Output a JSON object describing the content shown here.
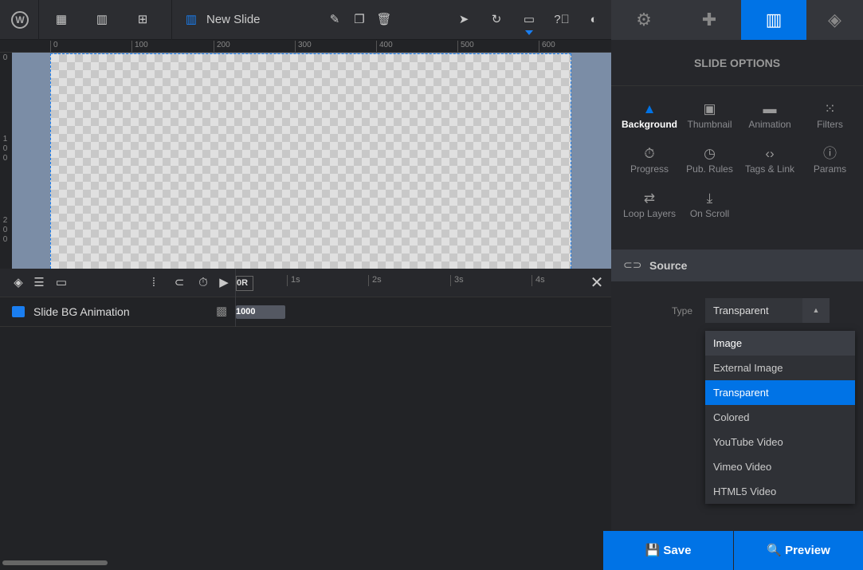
{
  "topbar": {
    "title": "New Slide",
    "icons": [
      "wordpress-icon",
      "grid-icon",
      "slides-icon",
      "add-slide-icon",
      "slide-icon",
      "pencil-icon",
      "copy-icon",
      "trash-icon",
      "cursor-icon",
      "undo-icon",
      "desktop-icon",
      "help-icon",
      "contrast-icon"
    ]
  },
  "ruler": {
    "h": [
      "0",
      "100",
      "200",
      "300",
      "400",
      "500",
      "600"
    ],
    "v": [
      "0",
      "1",
      "0",
      "0",
      "2",
      "0",
      "0"
    ]
  },
  "timeline": {
    "ticks": [
      "1s",
      "2s",
      "3s",
      "4s"
    ],
    "field": "0R",
    "row_label": "Slide BG Animation",
    "row_value": "1000"
  },
  "panel": {
    "tabs": [
      "gear-icon",
      "gamepad-icon",
      "slide-options-icon",
      "layers-icon"
    ],
    "active_tab": 2,
    "header": "SLIDE OPTIONS",
    "options": [
      {
        "label": "Background",
        "icon": "▲"
      },
      {
        "label": "Thumbnail",
        "icon": "▣"
      },
      {
        "label": "Animation",
        "icon": "▬"
      },
      {
        "label": "Filters",
        "icon": "⁙"
      },
      {
        "label": "Progress",
        "icon": "⏱"
      },
      {
        "label": "Pub. Rules",
        "icon": "◷"
      },
      {
        "label": "Tags & Link",
        "icon": "‹›"
      },
      {
        "label": "Params",
        "icon": "ⓘ"
      },
      {
        "label": "Loop Layers",
        "icon": "⇄"
      },
      {
        "label": "On Scroll",
        "icon": "⤓"
      }
    ],
    "active_option": 0,
    "section": "Source",
    "type_label": "Type",
    "type_value": "Transparent",
    "dropdown": [
      "Image",
      "External Image",
      "Transparent",
      "Colored",
      "YouTube Video",
      "Vimeo Video",
      "HTML5 Video"
    ],
    "selected": 2,
    "save": "Save",
    "preview": "Preview"
  },
  "colors": {
    "accent": "#0073e6"
  }
}
